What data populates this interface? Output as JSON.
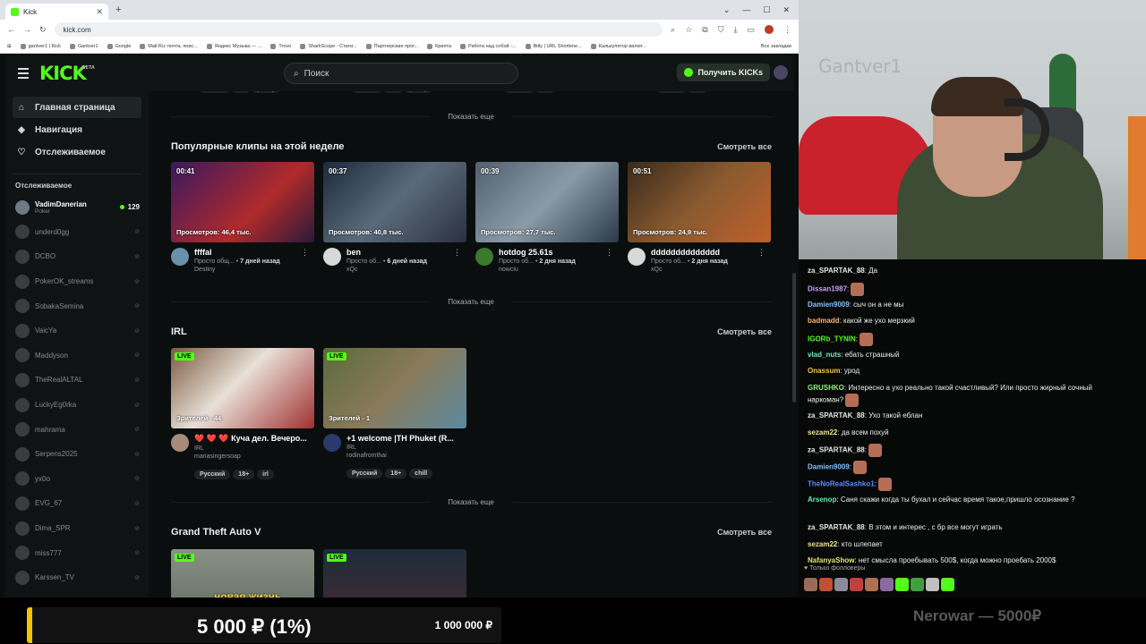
{
  "browser": {
    "tab_title": "Kick",
    "url": "kick.com",
    "bookmarks": [
      "gantver1 | Kick",
      "Gantver1",
      "Google",
      "Mail.Ru: почта, поис...",
      "Яндекс Музыка — ...",
      "Trovo",
      "SharkScope - Стати...",
      "Партнерские прог...",
      "Крипта",
      "Работа над собой -...",
      "Bitly | URL Shortene...",
      "Калькулятор валют..."
    ],
    "bookmarks_all": "Все закладки"
  },
  "header": {
    "logo": "KICK",
    "logo_sup": "BETA",
    "search_placeholder": "Поиск",
    "get_kicks": "Получить KICKs"
  },
  "sidebar": {
    "nav": [
      {
        "label": "Главная страница",
        "icon": "home-icon"
      },
      {
        "label": "Навигация",
        "icon": "compass-icon"
      },
      {
        "label": "Отслеживаемое",
        "icon": "heart-icon"
      }
    ],
    "following_title": "Отслеживаемое",
    "live": {
      "name": "VadimDanerian",
      "category": "Poker",
      "viewers": "129"
    },
    "offline": [
      "underd0gg",
      "DCBO",
      "PokerOK_streams",
      "SobakaSemina",
      "VaicYa",
      "Maddyson",
      "TheRealALTAL",
      "LuckyEg0rka",
      "mahrama",
      "Serpens2025",
      "yx0o",
      "EVG_67",
      "Dima_SPR",
      "miss777",
      "Karssen_TV"
    ]
  },
  "main": {
    "top_tags": [
      [
        "Russian",
        "18+",
        "gaming"
      ],
      [
        "Russian",
        "chill",
        "gaming"
      ],
      [
        "Russian",
        "18+"
      ],
      [
        "Russian",
        "18+"
      ]
    ],
    "show_more": "Показать еще",
    "see_all": "Смотреть все",
    "clips": {
      "title": "Популярные клипы на этой неделе",
      "items": [
        {
          "duration": "00:41",
          "views": "Просмотров: 46,4 тыс.",
          "title": "ffffal",
          "subtitle": "Просто общ...",
          "age": "7 дней назад",
          "channel": "Destiny"
        },
        {
          "duration": "00:37",
          "views": "Просмотров: 40,8 тыс.",
          "title": "ben",
          "subtitle": "Просто об...",
          "age": "6 дней назад",
          "channel": "xQc"
        },
        {
          "duration": "00:39",
          "views": "Просмотров: 27,7 тыс.",
          "title": "hotdog 25.61s",
          "subtitle": "Просто об...",
          "age": "2 дня назад",
          "channel": "nowciu"
        },
        {
          "duration": "00:51",
          "views": "Просмотров: 24,9 тыс.",
          "title": "dddddddddddddd",
          "subtitle": "Просто об...",
          "age": "2 дня назад",
          "channel": "xQc"
        }
      ]
    },
    "irl": {
      "title": "IRL",
      "items": [
        {
          "badge": "LIVE",
          "viewers": "Зрителей - 44",
          "title": "❤️ ❤️ ❤️ Куча дел. Вечеро...",
          "category": "IRL",
          "channel": "mariasingersoap",
          "tags": [
            "Русский",
            "18+",
            "irl"
          ]
        },
        {
          "badge": "LIVE",
          "viewers": "Зрителей - 1",
          "title": "+1 welcome |TH Phuket (R...",
          "category": "IRL",
          "channel": "rodinafromthai",
          "tags": [
            "Русский",
            "18+",
            "chill"
          ]
        }
      ]
    },
    "gta": {
      "title": "Grand Theft Auto V",
      "items": [
        {
          "badge": "LIVE",
          "overlay": "новая жизнь"
        },
        {
          "badge": "LIVE"
        }
      ]
    }
  },
  "cam": {
    "watermark": "Gantver1"
  },
  "chat": {
    "messages": [
      {
        "user": "za_SPARTAK_88",
        "color": "#e6e6e6",
        "text": "Да"
      },
      {
        "user": "Dissan1987",
        "color": "#c9a0ff",
        "text": "",
        "emote": true
      },
      {
        "user": "Damien9009",
        "color": "#7fc3ff",
        "text": "сыч он а не мы"
      },
      {
        "user": "badmadd",
        "color": "#ffb36b",
        "text": "какой же ухо мерзкий"
      },
      {
        "user": "IGORb_TYNIN",
        "color": "#53fc18",
        "text": "",
        "emote": true
      },
      {
        "user": "vlad_nuts",
        "color": "#6ee7c8",
        "text": "ебать страшный"
      },
      {
        "user": "Onassum",
        "color": "#f5c542",
        "text": "урод"
      },
      {
        "user": "GRUSHKO",
        "color": "#8ef07a",
        "text": "Интересно а ухо реально такой счастливый? Или просто жирный сочный наркоман?",
        "emote": true
      },
      {
        "user": "za_SPARTAK_88",
        "color": "#e6e6e6",
        "text": "Ухо такой еблан"
      },
      {
        "user": "sezam22",
        "color": "#f0e68c",
        "text": "да всем похуй"
      },
      {
        "user": "za_SPARTAK_88",
        "color": "#e6e6e6",
        "text": "",
        "emote": true
      },
      {
        "user": "Damien9009",
        "color": "#7fc3ff",
        "text": "",
        "emote": true
      },
      {
        "user": "TheNoRealSashko1",
        "color": "#5b8cff",
        "text": "",
        "emote": true
      },
      {
        "user": "Arsenop",
        "color": "#5ff0b0",
        "text": "Саня скажи когда ты бухал и сейчас время такое,пришло осознание ?"
      },
      {
        "user": "za_SPARTAK_88",
        "color": "#e6e6e6",
        "text": "В этом и интерес , с бр все могут играть"
      },
      {
        "user": "sezam22",
        "color": "#f0e68c",
        "text": "кто шлепает"
      },
      {
        "user": "NafanyaShow",
        "color": "#e8e86a",
        "text": "нет смысла проебывать 500$, когда можно проебать 2000$"
      }
    ],
    "followers_only": "Только фолловеры"
  },
  "goal": {
    "current": "5 000 ₽ (1%)",
    "target": "1 000 000 ₽",
    "progress": 0.01
  },
  "donor": "Nerowar — 5000₽"
}
